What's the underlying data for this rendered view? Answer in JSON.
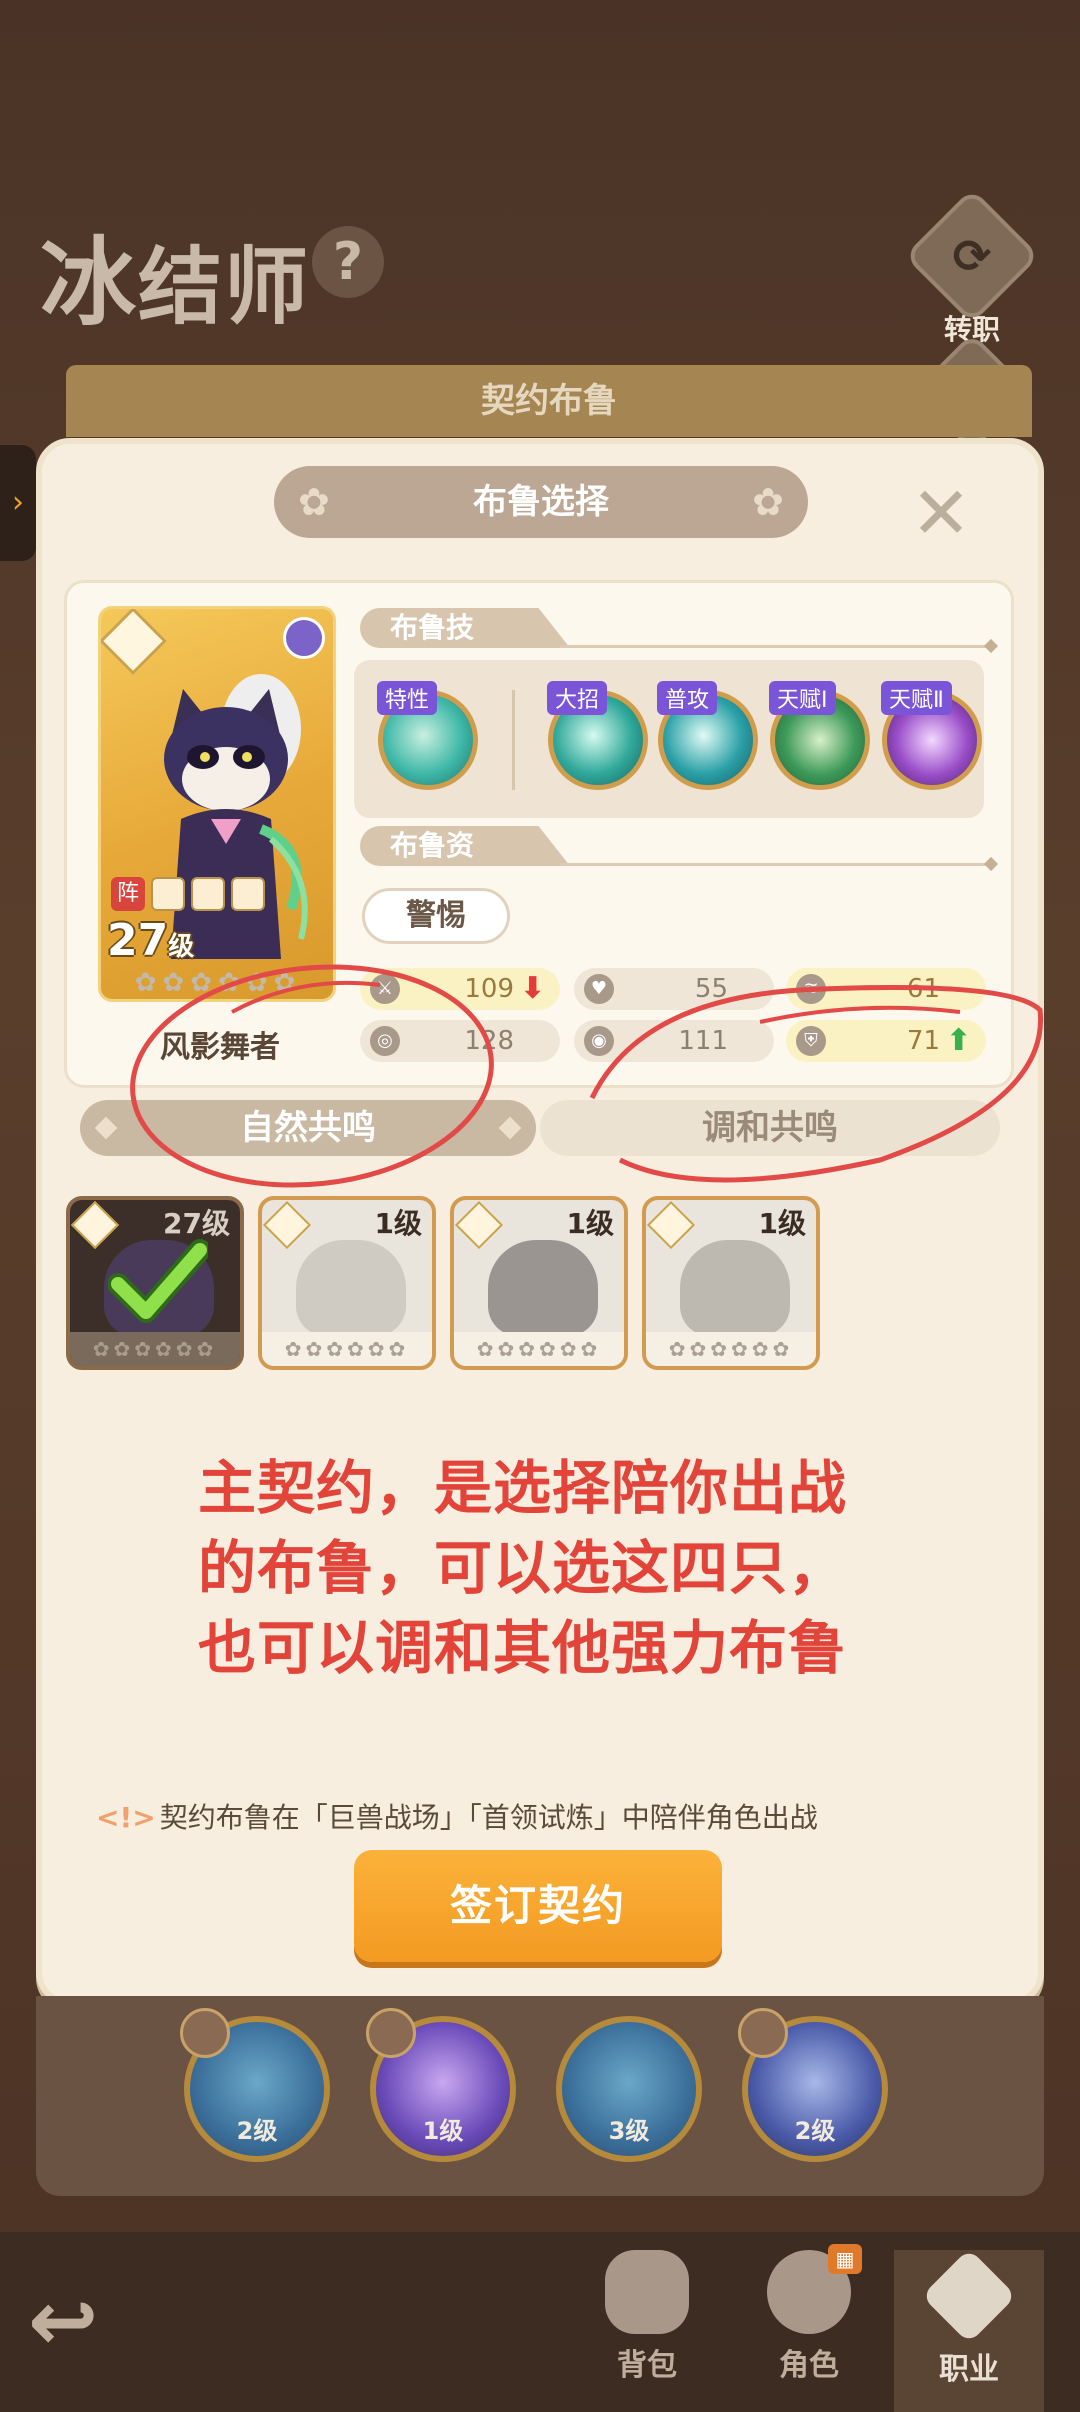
{
  "background": {
    "class_title_big": "冰",
    "class_title_rest": "结师",
    "help_icon": "?",
    "change_job_label": "转职",
    "banner_label": "契约布鲁"
  },
  "modal": {
    "title": "布鲁选择",
    "close_icon": "✕",
    "pet_level": "27",
    "pet_level_unit": "级",
    "pet_tag": "阵",
    "pet_name": "风影舞者",
    "skills_header": "布鲁技能",
    "skills": [
      {
        "label": "特性",
        "color": "#3fb8a8"
      },
      {
        "label": "大招",
        "color": "#2fa89a"
      },
      {
        "label": "普攻",
        "color": "#2aa0a6"
      },
      {
        "label": "天赋Ⅰ",
        "color": "#3e9a5a"
      },
      {
        "label": "天赋Ⅱ",
        "color": "#9a4ec8"
      }
    ],
    "aptitude_header": "布鲁资质",
    "trait": "警惕",
    "stats": [
      {
        "value": "109",
        "trend": "down"
      },
      {
        "value": "55",
        "trend": ""
      },
      {
        "value": "61",
        "trend": ""
      },
      {
        "value": "128",
        "trend": ""
      },
      {
        "value": "111",
        "trend": ""
      },
      {
        "value": "71",
        "trend": "up"
      }
    ],
    "resonance_left": "自然共鸣",
    "resonance_right": "调和共鸣",
    "pets": [
      {
        "level": "27级",
        "selected": true
      },
      {
        "level": "1级",
        "selected": false
      },
      {
        "level": "1级",
        "selected": false
      },
      {
        "level": "1级",
        "selected": false
      }
    ],
    "annotation": [
      "主契约，是选择陪你出战",
      "的布鲁，可以选这四只，",
      "也可以调和其他强力布鲁"
    ],
    "tip_icon": "<!>",
    "tip": "契约布鲁在「巨兽战场」「首领试炼」中陪伴角色出战",
    "sign_button": "签订契约"
  },
  "dock": {
    "skills": [
      {
        "level": "2级"
      },
      {
        "level": "1级"
      },
      {
        "level": "3级"
      },
      {
        "level": "2级"
      }
    ]
  },
  "nav": {
    "back_icon": "↩",
    "items": [
      {
        "label": "背包"
      },
      {
        "label": "角色"
      },
      {
        "label": "职业"
      }
    ]
  }
}
